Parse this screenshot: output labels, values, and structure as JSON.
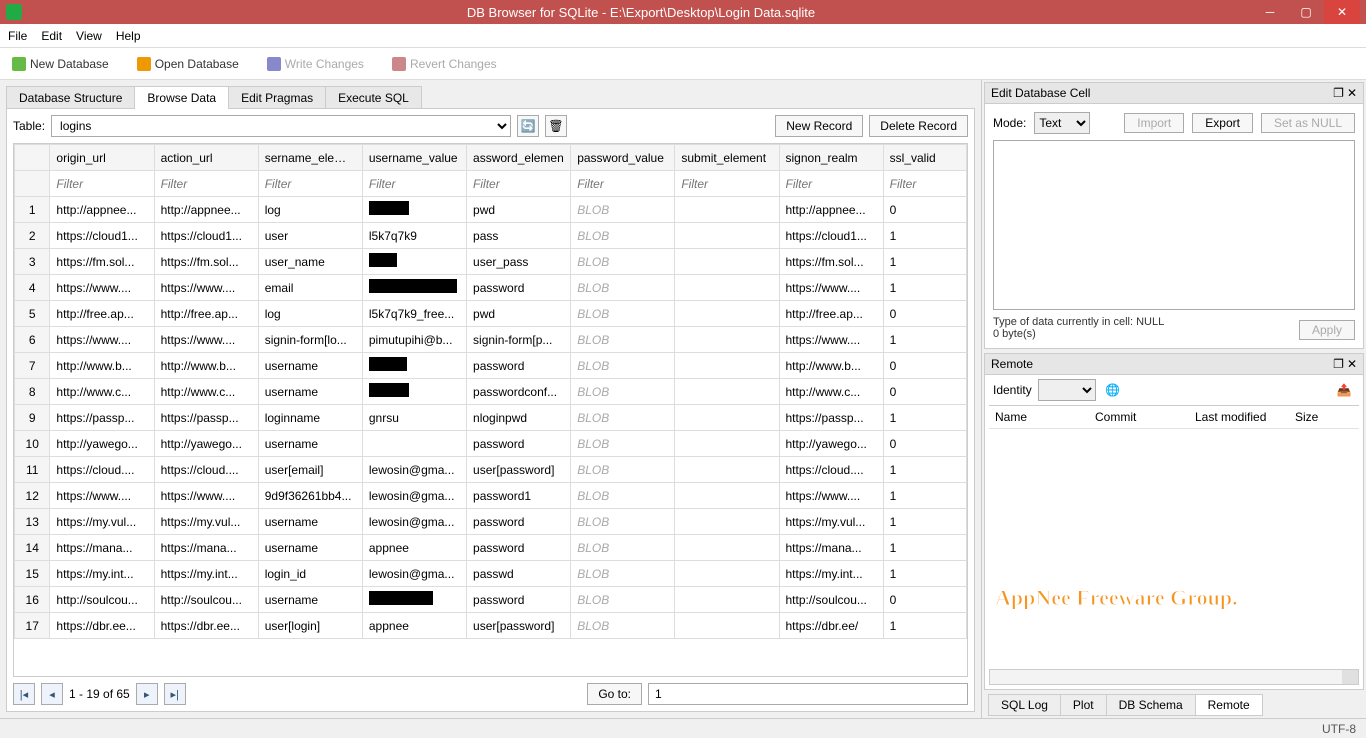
{
  "title": "DB Browser for SQLite - E:\\Export\\Desktop\\Login Data.sqlite",
  "menu": {
    "file": "File",
    "edit": "Edit",
    "view": "View",
    "help": "Help"
  },
  "toolbar": {
    "new_db": "New Database",
    "open_db": "Open Database",
    "write": "Write Changes",
    "revert": "Revert Changes"
  },
  "tabs": {
    "structure": "Database Structure",
    "browse": "Browse Data",
    "pragmas": "Edit Pragmas",
    "sql": "Execute SQL"
  },
  "table_label": "Table:",
  "table_selected": "logins",
  "new_record": "New Record",
  "delete_record": "Delete Record",
  "columns": [
    "origin_url",
    "action_url",
    "sername_elemen",
    "username_value",
    "assword_elemen",
    "password_value",
    "submit_element",
    "signon_realm",
    "ssl_valid"
  ],
  "filter_placeholder": "Filter",
  "rows": [
    {
      "n": 1,
      "cells": [
        "http://appnee...",
        "http://appnee...",
        "log",
        "[REDACT:40]",
        "pwd",
        "BLOB",
        "",
        "http://appnee...",
        "0"
      ]
    },
    {
      "n": 2,
      "cells": [
        "https://cloud1...",
        "https://cloud1...",
        "user",
        "l5k7q7k9",
        "pass",
        "BLOB",
        "",
        "https://cloud1...",
        "1"
      ]
    },
    {
      "n": 3,
      "cells": [
        "https://fm.sol...",
        "https://fm.sol...",
        "user_name",
        "[REDACT:28]",
        "user_pass",
        "BLOB",
        "",
        "https://fm.sol...",
        "1"
      ]
    },
    {
      "n": 4,
      "cells": [
        "https://www....",
        "https://www....",
        "email",
        "[REDACT:88].",
        "password",
        "BLOB",
        "",
        "https://www....",
        "1"
      ]
    },
    {
      "n": 5,
      "cells": [
        "http://free.ap...",
        "http://free.ap...",
        "log",
        "l5k7q7k9_free...",
        "pwd",
        "BLOB",
        "",
        "http://free.ap...",
        "0"
      ]
    },
    {
      "n": 6,
      "cells": [
        "https://www....",
        "https://www....",
        "signin-form[lo...",
        "pimutupihi@b...",
        "signin-form[p...",
        "BLOB",
        "",
        "https://www....",
        "1"
      ]
    },
    {
      "n": 7,
      "cells": [
        "http://www.b...",
        "http://www.b...",
        "username",
        "[REDACT:38]",
        "password",
        "BLOB",
        "",
        "http://www.b...",
        "0"
      ]
    },
    {
      "n": 8,
      "cells": [
        "http://www.c...",
        "http://www.c...",
        "username",
        "[REDACT:40]",
        "passwordconf...",
        "BLOB",
        "",
        "http://www.c...",
        "0"
      ]
    },
    {
      "n": 9,
      "cells": [
        "https://passp...",
        "https://passp...",
        "loginname",
        "gnrsu",
        "nloginpwd",
        "BLOB",
        "",
        "https://passp...",
        "1"
      ]
    },
    {
      "n": 10,
      "cells": [
        "http://yawego...",
        "http://yawego...",
        "username",
        "",
        "password",
        "BLOB",
        "",
        "http://yawego...",
        "0"
      ]
    },
    {
      "n": 11,
      "cells": [
        "https://cloud....",
        "https://cloud....",
        "user[email]",
        "lewosin@gma...",
        "user[password]",
        "BLOB",
        "",
        "https://cloud....",
        "1"
      ]
    },
    {
      "n": 12,
      "cells": [
        "https://www....",
        "https://www....",
        "9d9f36261bb4...",
        "lewosin@gma...",
        "password1",
        "BLOB",
        "",
        "https://www....",
        "1"
      ]
    },
    {
      "n": 13,
      "cells": [
        "https://my.vul...",
        "https://my.vul...",
        "username",
        "lewosin@gma...",
        "password",
        "BLOB",
        "",
        "https://my.vul...",
        "1"
      ]
    },
    {
      "n": 14,
      "cells": [
        "https://mana...",
        "https://mana...",
        "username",
        "appnee",
        "password",
        "BLOB",
        "",
        "https://mana...",
        "1"
      ]
    },
    {
      "n": 15,
      "cells": [
        "https://my.int...",
        "https://my.int...",
        "login_id",
        "lewosin@gma...",
        "passwd",
        "BLOB",
        "",
        "https://my.int...",
        "1"
      ]
    },
    {
      "n": 16,
      "cells": [
        "http://soulcou...",
        "http://soulcou...",
        "username",
        "[REDACT:64]",
        "password",
        "BLOB",
        "",
        "http://soulcou...",
        "0"
      ]
    },
    {
      "n": 17,
      "cells": [
        "https://dbr.ee...",
        "https://dbr.ee...",
        "user[login]",
        "appnee",
        "user[password]",
        "BLOB",
        "",
        "https://dbr.ee/",
        "1"
      ]
    }
  ],
  "pager_text": "1 - 19 of 65",
  "goto_label": "Go to:",
  "goto_value": "1",
  "right": {
    "edit_cell": "Edit Database Cell",
    "mode": "Mode:",
    "mode_value": "Text",
    "import": "Import",
    "export": "Export",
    "set_null": "Set as NULL",
    "type_info": "Type of data currently in cell: NULL",
    "size_info": "0 byte(s)",
    "apply": "Apply",
    "remote": "Remote",
    "identity": "Identity",
    "cols": {
      "name": "Name",
      "commit": "Commit",
      "last": "Last modified",
      "size": "Size"
    },
    "watermark": "AppNee Freeware Group."
  },
  "bottom_tabs": {
    "sqllog": "SQL Log",
    "plot": "Plot",
    "schema": "DB Schema",
    "remote": "Remote"
  },
  "status": "UTF-8"
}
